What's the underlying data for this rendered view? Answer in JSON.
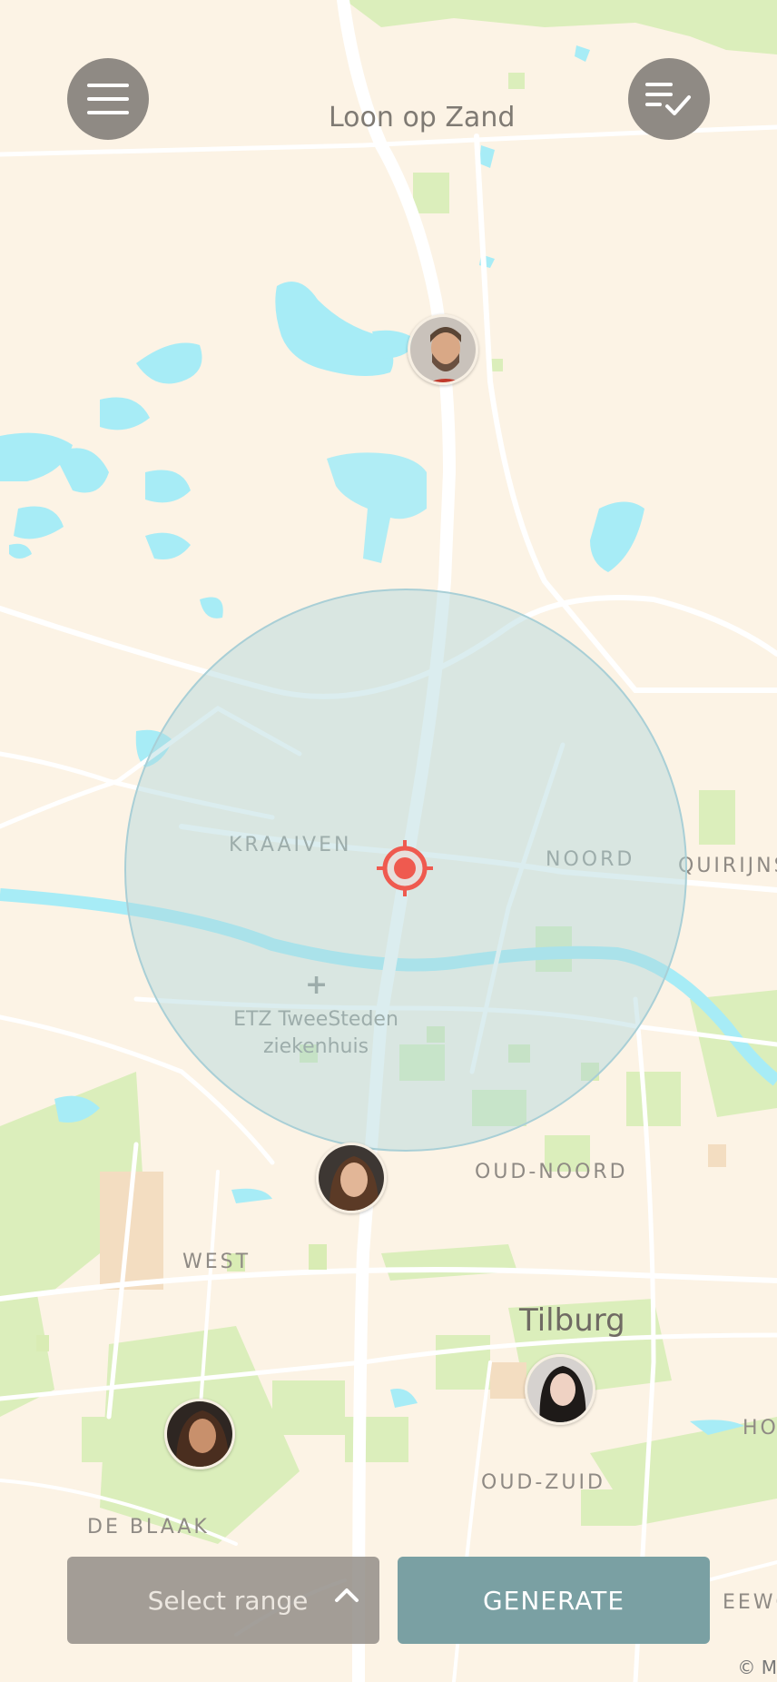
{
  "map": {
    "labels": {
      "loon_op_zand": "Loon op Zand",
      "kraaiven": "KRAAIVEN",
      "noord": "NOORD",
      "quirijns": "QUIRIJNS",
      "etz_line1": "ETZ TweeSteden",
      "etz_line2": "ziekenhuis",
      "oud_noord": "OUD-NOORD",
      "west": "WEST",
      "tilburg": "Tilburg",
      "oud_zuid": "OUD-ZUID",
      "de_blaak": "DE BLAAK",
      "ho": "HO",
      "eewou": "EEWOU"
    },
    "attribution": "© M"
  },
  "header": {
    "menu_icon": "hamburger-menu-icon",
    "checklist_icon": "checklist-icon"
  },
  "range_circle": {
    "target_icon": "crosshair-target-icon",
    "accent": "#ef5a4f"
  },
  "avatars": [
    "man-bearded",
    "woman-brunette-long-hair",
    "woman-dark-hair",
    "woman-brown-hair"
  ],
  "footer": {
    "select_range_label": "Select range",
    "select_range_icon": "chevron-up-icon",
    "generate_label": "GENERATE"
  },
  "colors": {
    "fab_bg": "#8f8a84",
    "generate_bg": "#7aa0a3",
    "water": "#a7ecf6",
    "park": "#d9ecb4",
    "land": "#fcf3e5"
  }
}
